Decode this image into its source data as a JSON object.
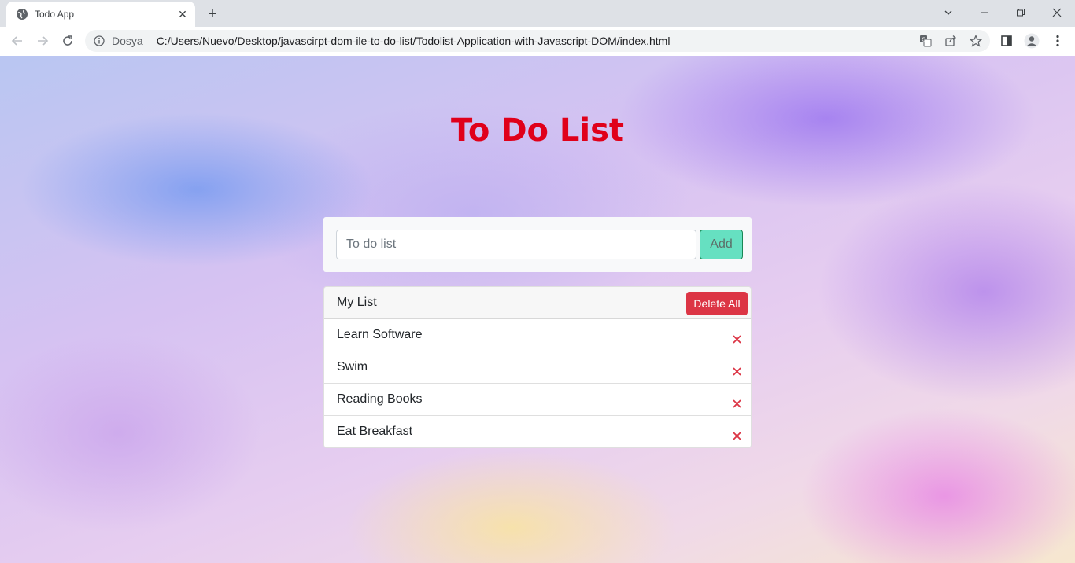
{
  "browser": {
    "tab_title": "Todo App",
    "site_label": "Dosya",
    "url": "C:/Users/Nuevo/Desktop/javascirpt-dom-ile-to-do-list/Todolist-Application-with-Javascript-DOM/index.html"
  },
  "page": {
    "title": "To Do List",
    "input_placeholder": "To do list",
    "input_value": "",
    "add_label": "Add",
    "list_title": "My List",
    "delete_all_label": "Delete All",
    "items": [
      {
        "label": "Learn Software"
      },
      {
        "label": "Swim"
      },
      {
        "label": "Reading Books"
      },
      {
        "label": "Eat Breakfast"
      }
    ]
  },
  "colors": {
    "title": "#e0001a",
    "add_button": "#66e0c1",
    "delete_all": "#dc3545",
    "item_delete_icon": "#dc3545"
  },
  "icons": {
    "tab": "globe-icon",
    "item_delete": "close-icon"
  }
}
